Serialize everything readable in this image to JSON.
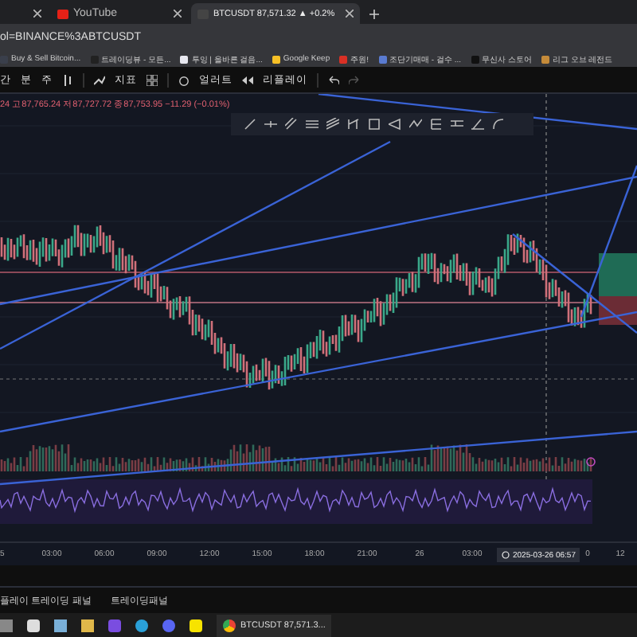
{
  "browser": {
    "tabs": [
      {
        "title": "YouTube",
        "selected": false
      },
      {
        "title": "BTCUSDT 87,571.32 ▲ +0.2%",
        "selected": true
      }
    ],
    "address": "ol=BINANCE%3ABTCUSDT",
    "bookmarks": [
      {
        "label": "Buy & Sell Bitcoin...",
        "color": "#3a3f4b"
      },
      {
        "label": "트레이딩뷰 - 모든...",
        "color": "#222222"
      },
      {
        "label": "투잉 | 올바른 걸음...",
        "color": "#e8e8f0"
      },
      {
        "label": "Google Keep",
        "color": "#f6c026"
      },
      {
        "label": "주원!",
        "color": "#d93025"
      },
      {
        "label": "조단기매매 - 걸수 ...",
        "color": "#5a7bd0"
      },
      {
        "label": "무신사 스토어",
        "color": "#111111"
      },
      {
        "label": "리그 오브 레전드",
        "color": "#c58b3a"
      }
    ]
  },
  "toolbar": {
    "items": [
      "간",
      "분",
      "주",
      "지표",
      "얼러트",
      "리플레이"
    ]
  },
  "chart": {
    "ohlc": "24 고87,765.24 저87,727.72 종87,753.95 −11.29 (−0.01%)",
    "time_axis": [
      "5",
      "03:00",
      "06:00",
      "09:00",
      "12:00",
      "15:00",
      "18:00",
      "21:00",
      "26",
      "03:00",
      "0",
      "12"
    ],
    "crosshair_time": "2025-03-26  06:57"
  },
  "bottom_panel": {
    "tabs": [
      "플레이 트레이딩 패널",
      "트레이딩패널"
    ]
  },
  "taskbar": {
    "active_window": "BTCUSDT 87,571.3..."
  }
}
